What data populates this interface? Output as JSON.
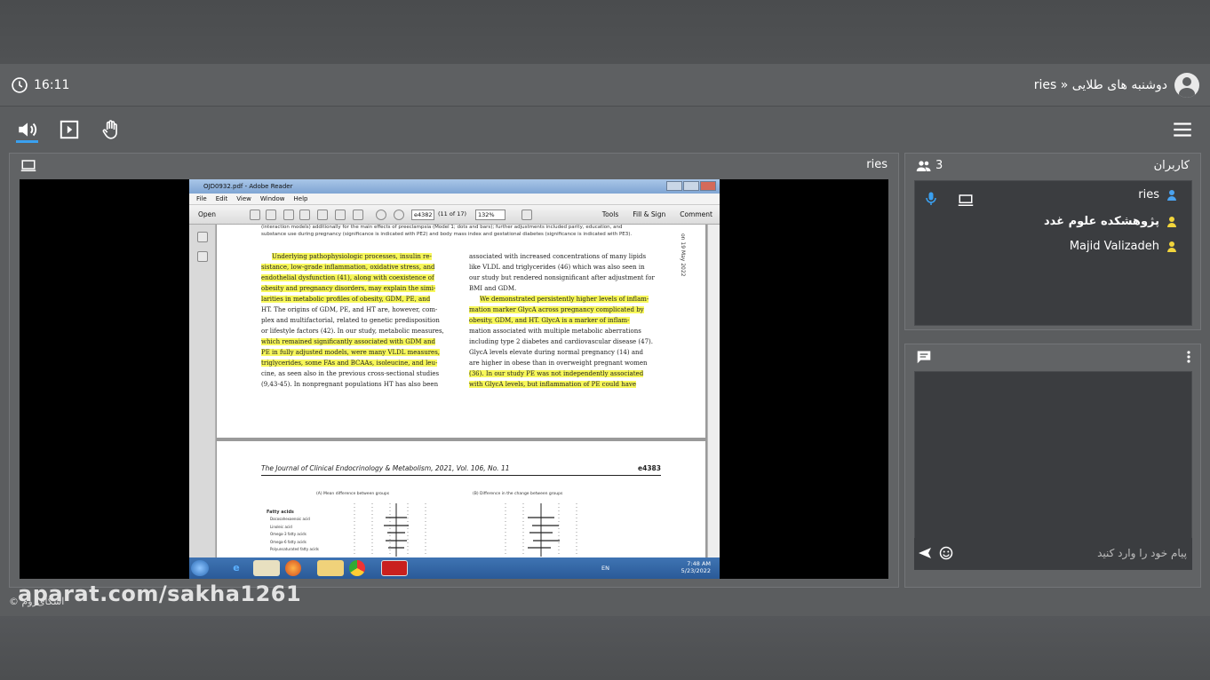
{
  "header": {
    "time": "16:11",
    "room_title": "ries » دوشنبه های طلایی"
  },
  "share_panel": {
    "presenter": "ries"
  },
  "screen_share": {
    "window_title": "OJD0932.pdf - Adobe Reader",
    "menu": [
      "File",
      "Edit",
      "View",
      "Window",
      "Help"
    ],
    "open_label": "Open",
    "page_value": "e4382",
    "page_of": "(11 of 17)",
    "zoom": "132%",
    "tools": [
      "Tools",
      "Fill & Sign",
      "Comment"
    ],
    "caption_line1": "(interaction models) additionally for the main effects of preeclampsia (Model 1; dots and bars); further adjustments included parity, education, and",
    "caption_line2": "substance use during pregnancy (significance is indicated with PE2) and body mass index and gestational diabetes (significance is indicated with PE3).",
    "left_col": [
      "Underlying pathophysiologic processes, insulin re-",
      "sistance, low-grade inflammation, oxidative stress, and",
      "endothelial dysfunction (41), along with coexistence of",
      "obesity and pregnancy disorders, may explain the simi-",
      "larities in metabolic profiles of obesity, GDM, PE, and",
      "HT. The origins of GDM, PE, and HT are, however, com-",
      "plex and multifactorial, related to genetic predisposition",
      "or lifestyle factors (42). In our study, metabolic measures,",
      "which remained significantly associated with GDM and",
      "PE in fully adjusted models, were many VLDL measures,",
      "triglycerides, some FAs and BCAAs, isoleucine, and leu-",
      "cine, as seen also in the previous cross-sectional studies",
      "(9,43-45). In nonpregnant populations HT has also been"
    ],
    "right_col": [
      "associated with increased concentrations of many lipids",
      "like VLDL and triglycerides (46) which was also seen in",
      "our study but rendered nonsignificant after adjustment for",
      "BMI and GDM.",
      "We demonstrated persistently higher levels of inflam-",
      "mation marker GlycA across pregnancy complicated by",
      "obesity, GDM, and HT. GlycA is a marker of inflam-",
      "mation associated with multiple metabolic aberrations",
      "including type 2 diabetes and cardiovascular disease (47).",
      "GlycA levels elevate during normal pregnancy (14) and",
      "are higher in obese than in overweight pregnant women",
      "(36). In our study PE was not independently associated",
      "with GlycA levels, but inflammation of PE could have"
    ],
    "side_text": "on 19 May 2022",
    "journal_line": "The Journal of Clinical Endocrinology & Metabolism, 2021, Vol. 106, No. 11",
    "page_number": "e4383",
    "fig_a": "(A) Mean difference between groups",
    "fig_b": "(B) Difference in the change between groups",
    "fig_row0": "Fatty acids",
    "fig_rows": [
      "Docosahexaenoic acid",
      "Linoleic acid",
      "Omega-3 fatty acids",
      "Omega-6 fatty acids",
      "Polyunsaturated fatty acids"
    ],
    "taskbar_lang": "EN",
    "taskbar_time": "7:48 AM",
    "taskbar_date": "5/23/2022"
  },
  "users_panel": {
    "count": "3",
    "title": "کاربران",
    "users": [
      {
        "name": "ries",
        "color": "#4aa3f0"
      },
      {
        "name": "پژوهشکده علوم غدد",
        "color": "#f2d53c"
      },
      {
        "name": "Majid Valizadeh",
        "color": "#f2d53c"
      }
    ]
  },
  "chat_panel": {
    "placeholder": "پیام خود را وارد کنید"
  },
  "watermark": {
    "site": "aparat.com/sakha1261",
    "brand": "© اسکای‌روم"
  }
}
